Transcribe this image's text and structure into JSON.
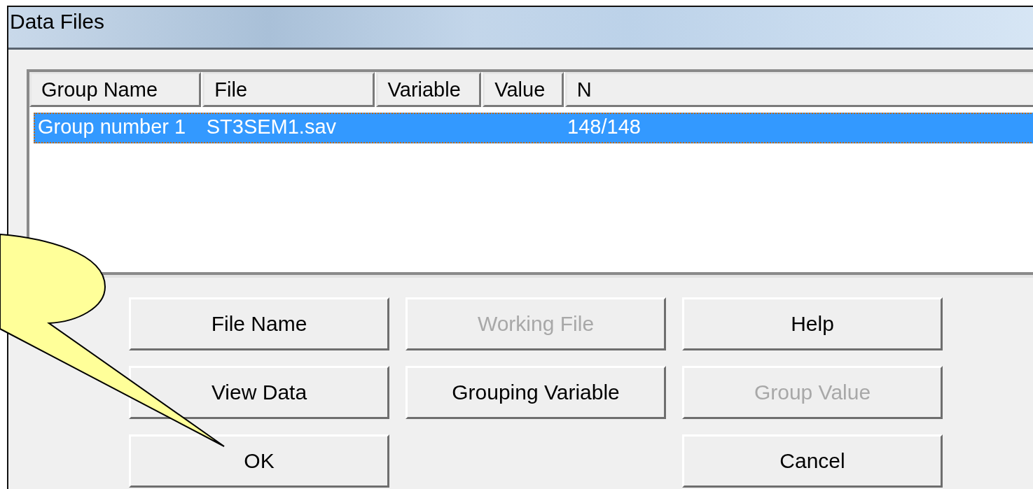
{
  "window": {
    "title": "Data Files"
  },
  "table": {
    "columns": [
      "Group Name",
      "File",
      "Variable",
      "Value",
      "N"
    ],
    "rows": [
      {
        "cells": [
          "Group number 1",
          "ST3SEM1.sav",
          null,
          null,
          "148/148"
        ],
        "selected": true
      }
    ]
  },
  "button_rows": [
    [
      {
        "kind": "button",
        "label": "File Name",
        "disabled": false
      },
      {
        "kind": "button",
        "label": "Working File",
        "disabled": true
      },
      {
        "kind": "button",
        "label": "Help",
        "disabled": false
      }
    ],
    [
      {
        "kind": "button",
        "label": "View Data",
        "disabled": false
      },
      {
        "kind": "button",
        "label": "Grouping Variable",
        "disabled": false
      },
      {
        "kind": "button",
        "label": "Group Value",
        "disabled": true
      }
    ],
    [
      {
        "kind": "button",
        "label": "OK",
        "disabled": false
      },
      {
        "kind": "spacer"
      },
      {
        "kind": "button",
        "label": "Cancel",
        "disabled": false
      }
    ]
  ]
}
